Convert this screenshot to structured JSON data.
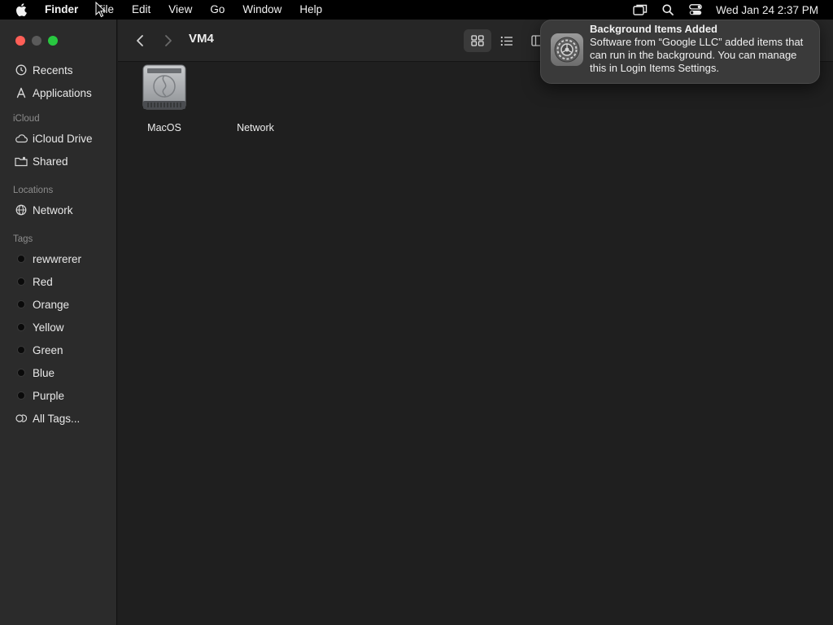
{
  "menubar": {
    "app_name": "Finder",
    "items": [
      "File",
      "Edit",
      "View",
      "Go",
      "Window",
      "Help"
    ],
    "clock": "Wed Jan 24  2:37 PM"
  },
  "window": {
    "title": "VM4"
  },
  "sidebar": {
    "favorites": [
      {
        "label": "Recents",
        "icon": "clock-icon"
      },
      {
        "label": "Applications",
        "icon": "applications-icon"
      }
    ],
    "icloud_header": "iCloud",
    "icloud": [
      {
        "label": "iCloud Drive",
        "icon": "cloud-icon"
      },
      {
        "label": "Shared",
        "icon": "shared-folder-icon"
      }
    ],
    "locations_header": "Locations",
    "locations": [
      {
        "label": "Network",
        "icon": "globe-icon"
      }
    ],
    "tags_header": "Tags",
    "tags": [
      {
        "label": "rewwrerer"
      },
      {
        "label": "Red"
      },
      {
        "label": "Orange"
      },
      {
        "label": "Yellow"
      },
      {
        "label": "Green"
      },
      {
        "label": "Blue"
      },
      {
        "label": "Purple"
      }
    ],
    "all_tags": "All Tags..."
  },
  "files": [
    {
      "label": "MacOS",
      "icon": "hard-drive-icon"
    },
    {
      "label": "Network",
      "icon": "network-icon"
    }
  ],
  "notification": {
    "title": "Background Items Added",
    "body": "Software from “Google LLC” added items that can run in the background. You can manage this in Login Items Settings.",
    "icon": "system-settings-icon"
  },
  "colors": {
    "close": "#ff5f57",
    "minimize": "#5a5a5a",
    "zoom": "#28c840",
    "tag_dot": "#0a0a0a"
  }
}
